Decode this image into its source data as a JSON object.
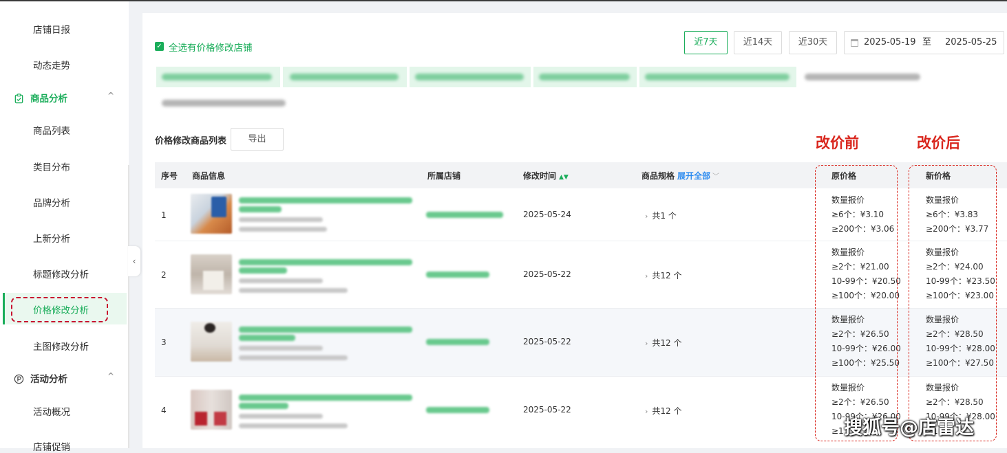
{
  "sidebar": {
    "items_top": [
      {
        "label": "店铺日报"
      },
      {
        "label": "动态走势"
      }
    ],
    "group_product": {
      "label": "商品分析",
      "chevron": "^"
    },
    "items_product": [
      {
        "label": "商品列表"
      },
      {
        "label": "类目分布"
      },
      {
        "label": "品牌分析"
      },
      {
        "label": "上新分析"
      },
      {
        "label": "标题修改分析"
      },
      {
        "label": "价格修改分析"
      },
      {
        "label": "主图修改分析"
      }
    ],
    "group_activity": {
      "label": "活动分析",
      "chevron": "^"
    },
    "items_activity": [
      {
        "label": "活动概况"
      },
      {
        "label": "店铺促销"
      }
    ],
    "collapse_glyph": "‹"
  },
  "filters": {
    "select_all_label": "全选有价格修改店铺",
    "check_glyph": "✓",
    "ranges": [
      {
        "label": "近7天",
        "active": true
      },
      {
        "label": "近14天",
        "active": false
      },
      {
        "label": "近30天",
        "active": false
      }
    ],
    "date_start": "2025-05-19",
    "date_sep": "至",
    "date_end": "2025-05-25"
  },
  "list": {
    "title": "价格修改商品列表",
    "export_label": "导出"
  },
  "annotations": {
    "before_label": "改价前",
    "after_label": "改价后",
    "watermark": "搜狐号@店雷达"
  },
  "table": {
    "headers": {
      "index": "序号",
      "product": "商品信息",
      "store": "所属店铺",
      "modified": "修改时间",
      "sort_glyph": "▲▼",
      "spec": "商品规格",
      "expand_all": "展开全部",
      "expand_glyph": "﹀",
      "old_price": "原价格",
      "new_price": "新价格"
    },
    "rows": [
      {
        "index": "1",
        "modified": "2025-05-24",
        "spec": "共1 个",
        "old_price": {
          "title": "数量报价",
          "lines": [
            "≥6个：¥3.10",
            "≥200个：¥3.06"
          ]
        },
        "new_price": {
          "title": "数量报价",
          "lines": [
            "≥6个：¥3.83",
            "≥200个：¥3.77"
          ]
        }
      },
      {
        "index": "2",
        "modified": "2025-05-22",
        "spec": "共12 个",
        "old_price": {
          "title": "数量报价",
          "lines": [
            "≥2个：¥21.00",
            "10-99个：¥20.50",
            "≥100个：¥20.00"
          ]
        },
        "new_price": {
          "title": "数量报价",
          "lines": [
            "≥2个：¥24.00",
            "10-99个：¥23.50",
            "≥100个：¥23.00"
          ]
        }
      },
      {
        "index": "3",
        "modified": "2025-05-22",
        "spec": "共12 个",
        "old_price": {
          "title": "数量报价",
          "lines": [
            "≥2个：¥26.50",
            "10-99个：¥26.00",
            "≥100个：¥25.50"
          ]
        },
        "new_price": {
          "title": "数量报价",
          "lines": [
            "≥2个：¥28.50",
            "10-99个：¥28.00",
            "≥100个：¥27.50"
          ]
        }
      },
      {
        "index": "4",
        "modified": "2025-05-22",
        "spec": "共12 个",
        "old_price": {
          "title": "数量报价",
          "lines": [
            "≥2个：¥26.50",
            "10-99个：¥26.00",
            "≥1"
          ]
        },
        "new_price": {
          "title": "数量报价",
          "lines": [
            "≥2个：¥28.50",
            "10-99个：¥28.00",
            "≥1"
          ]
        }
      }
    ]
  },
  "colors": {
    "accent_green": "#1aad5a",
    "annotation_red": "#d9251c",
    "link_blue": "#2d8cf0"
  },
  "icons": {
    "product_group": "clipboard-icon",
    "activity_group": "p-circle-icon",
    "calendar": "calendar-icon",
    "spec_expand": "chevron-right-icon"
  }
}
